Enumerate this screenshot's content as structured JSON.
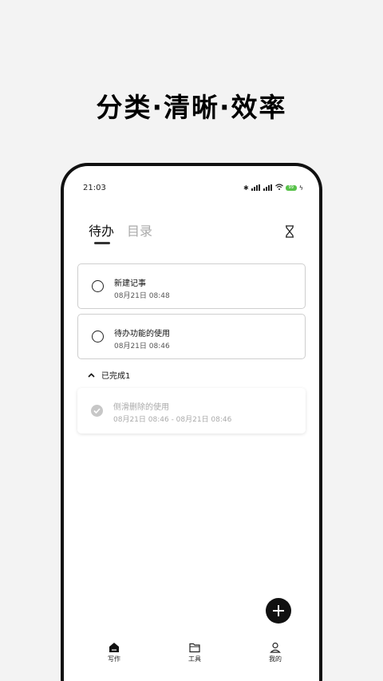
{
  "headline": "分类·清晰·效率",
  "status_bar": {
    "time": "21:03",
    "battery": "99"
  },
  "tabs": [
    {
      "label": "待办",
      "active": true
    },
    {
      "label": "目录",
      "active": false
    }
  ],
  "todos": [
    {
      "title": "新建记事",
      "time": "08月21日 08:48"
    },
    {
      "title": "待办功能的使用",
      "time": "08月21日 08:46"
    }
  ],
  "completed": {
    "header": "已完成1",
    "items": [
      {
        "title": "侧滑删除的使用",
        "time": "08月21日 08:46 - 08月21日 08:46"
      }
    ]
  },
  "bottom_nav": [
    {
      "label": "写作",
      "icon": "home-icon"
    },
    {
      "label": "工具",
      "icon": "folder-icon"
    },
    {
      "label": "我的",
      "icon": "user-icon"
    }
  ],
  "colors": {
    "background": "#f3f3f3",
    "accent": "#111111",
    "battery": "#58c24a",
    "muted": "#aaaaaa"
  }
}
